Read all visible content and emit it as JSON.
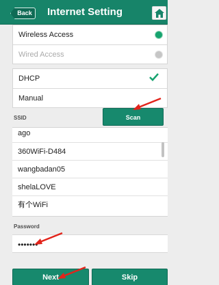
{
  "header": {
    "back_label": "Back",
    "title": "Internet Setting",
    "home_icon": "home-icon"
  },
  "access": {
    "items": [
      {
        "label": "Wireless Access",
        "selected": true
      },
      {
        "label": "Wired Access",
        "selected": false
      }
    ]
  },
  "ip_mode": {
    "items": [
      {
        "label": "DHCP",
        "selected": true
      },
      {
        "label": "Manual",
        "selected": false
      }
    ]
  },
  "wifi": {
    "ssid_label": "SSID",
    "scan_label": "Scan",
    "networks": [
      "ago",
      "360WiFi-D484",
      "wangbadan05",
      "shelaLOVE",
      "有个WiFi"
    ]
  },
  "password": {
    "label": "Password",
    "value": "•••••••"
  },
  "footer": {
    "next_label": "Next",
    "skip_label": "Skip"
  },
  "colors": {
    "header": "#178469",
    "accent": "#17896d",
    "annotation_arrow": "#e2241b"
  }
}
